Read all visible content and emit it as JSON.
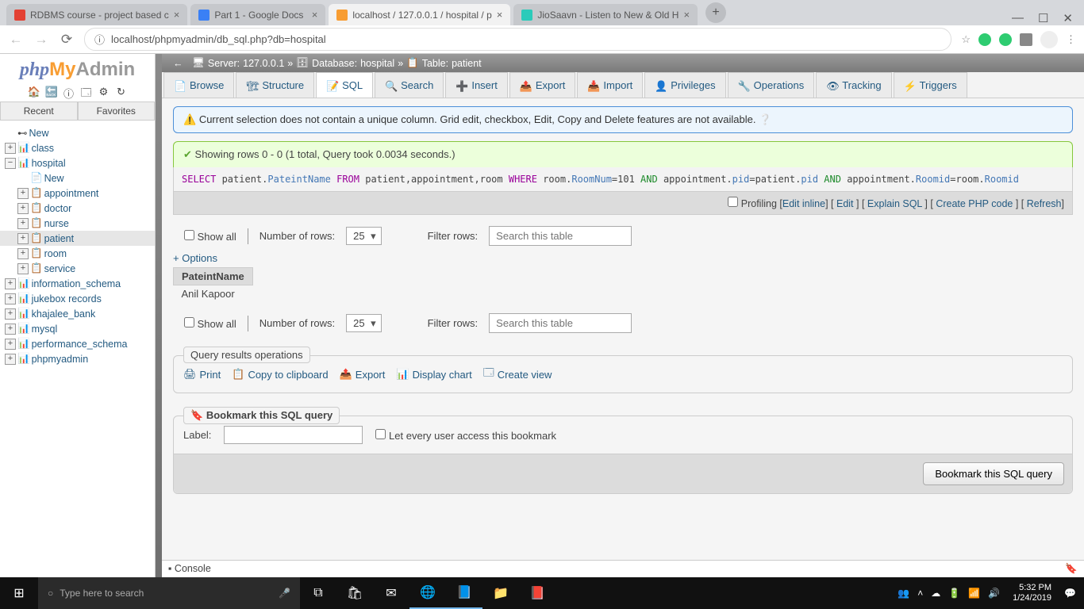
{
  "browser_tabs": [
    {
      "title": "RDBMS course - project based c",
      "icon": "gmail"
    },
    {
      "title": "Part 1 - Google Docs",
      "icon": "docs"
    },
    {
      "title": "localhost / 127.0.0.1 / hospital / p",
      "icon": "pma",
      "active": true
    },
    {
      "title": "JioSaavn - Listen to New & Old H",
      "icon": "saavn"
    }
  ],
  "url": "localhost/phpmyadmin/db_sql.php?db=hospital",
  "url_prefix": "ⓘ",
  "logo": {
    "php": "php",
    "my": "My",
    "admin": "Admin"
  },
  "sidebar_tabs": {
    "recent": "Recent",
    "favorites": "Favorites"
  },
  "tree": {
    "new": "New",
    "dbs": [
      "class"
    ],
    "hospital": "hospital",
    "hospital_children": {
      "new": "New",
      "tables": [
        "appointment",
        "doctor",
        "nurse",
        "patient",
        "room",
        "service"
      ]
    },
    "rest": [
      "information_schema",
      "jukebox records",
      "khajalee_bank",
      "mysql",
      "performance_schema",
      "phpmyadmin"
    ]
  },
  "breadcrumb": {
    "server_label": "Server:",
    "server": "127.0.0.1",
    "db_label": "Database:",
    "db": "hospital",
    "table_label": "Table:",
    "table": "patient"
  },
  "topnav": [
    "Browse",
    "Structure",
    "SQL",
    "Search",
    "Insert",
    "Export",
    "Import",
    "Privileges",
    "Operations",
    "Tracking",
    "Triggers"
  ],
  "alerts": {
    "warning": "Current selection does not contain a unique column. Grid edit, checkbox, Edit, Copy and Delete features are not available.",
    "success": "Showing rows 0 - 0 (1 total, Query took 0.0034 seconds.)"
  },
  "sql": {
    "select": "SELECT",
    "from": "FROM",
    "where": "WHERE",
    "and": "AND",
    "p1": " patient.",
    "col1": "PateintName",
    "p2": " patient,appointment,room ",
    "p3": " room.",
    "col2": "RoomNum",
    "eq101": "=101 ",
    "p4": " appointment.",
    "col3": "pid",
    "eqpid": "=patient.",
    "p5": " appointment.",
    "col4": "Roomid",
    "eqroom": "=room.",
    "col5": "Roomid"
  },
  "sql_actions": {
    "profiling": "Profiling",
    "edit_inline": "Edit inline",
    "edit": "Edit",
    "explain": "Explain SQL",
    "php": "Create PHP code",
    "refresh": "Refresh"
  },
  "table_controls": {
    "show_all": "Show all",
    "rows_label": "Number of rows:",
    "rows_value": "25",
    "filter_label": "Filter rows:",
    "filter_placeholder": "Search this table"
  },
  "options_link": "+ Options",
  "results": {
    "header": "PateintName",
    "rows": [
      "Anil Kapoor"
    ]
  },
  "ops_legend": "Query results operations",
  "ops": {
    "print": "Print",
    "copy": "Copy to clipboard",
    "export": "Export",
    "chart": "Display chart",
    "view": "Create view"
  },
  "bookmark": {
    "legend": "Bookmark this SQL query",
    "label": "Label:",
    "everyone": "Let every user access this bookmark",
    "button": "Bookmark this SQL query"
  },
  "console": "Console",
  "taskbar": {
    "search_placeholder": "Type here to search",
    "time": "5:32 PM",
    "date": "1/24/2019"
  }
}
